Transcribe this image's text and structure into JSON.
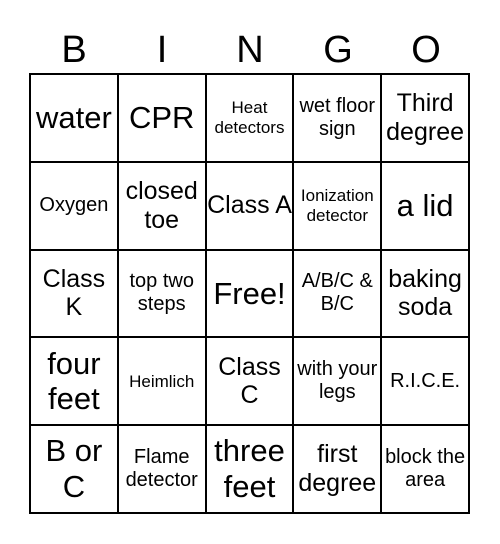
{
  "header": [
    "B",
    "I",
    "N",
    "G",
    "O"
  ],
  "cells": [
    [
      "water",
      "CPR",
      "Heat detectors",
      "wet floor sign",
      "Third degree"
    ],
    [
      "Oxygen",
      "closed toe",
      "Class A",
      "Ionization detector",
      "a lid"
    ],
    [
      "Class K",
      "top two steps",
      "Free!",
      "A/B/C & B/C",
      "baking soda"
    ],
    [
      "four feet",
      "Heimlich",
      "Class C",
      "with your legs",
      "R.I.C.E."
    ],
    [
      "B or C",
      "Flame detector",
      "three feet",
      "first degree",
      "block the area"
    ]
  ]
}
